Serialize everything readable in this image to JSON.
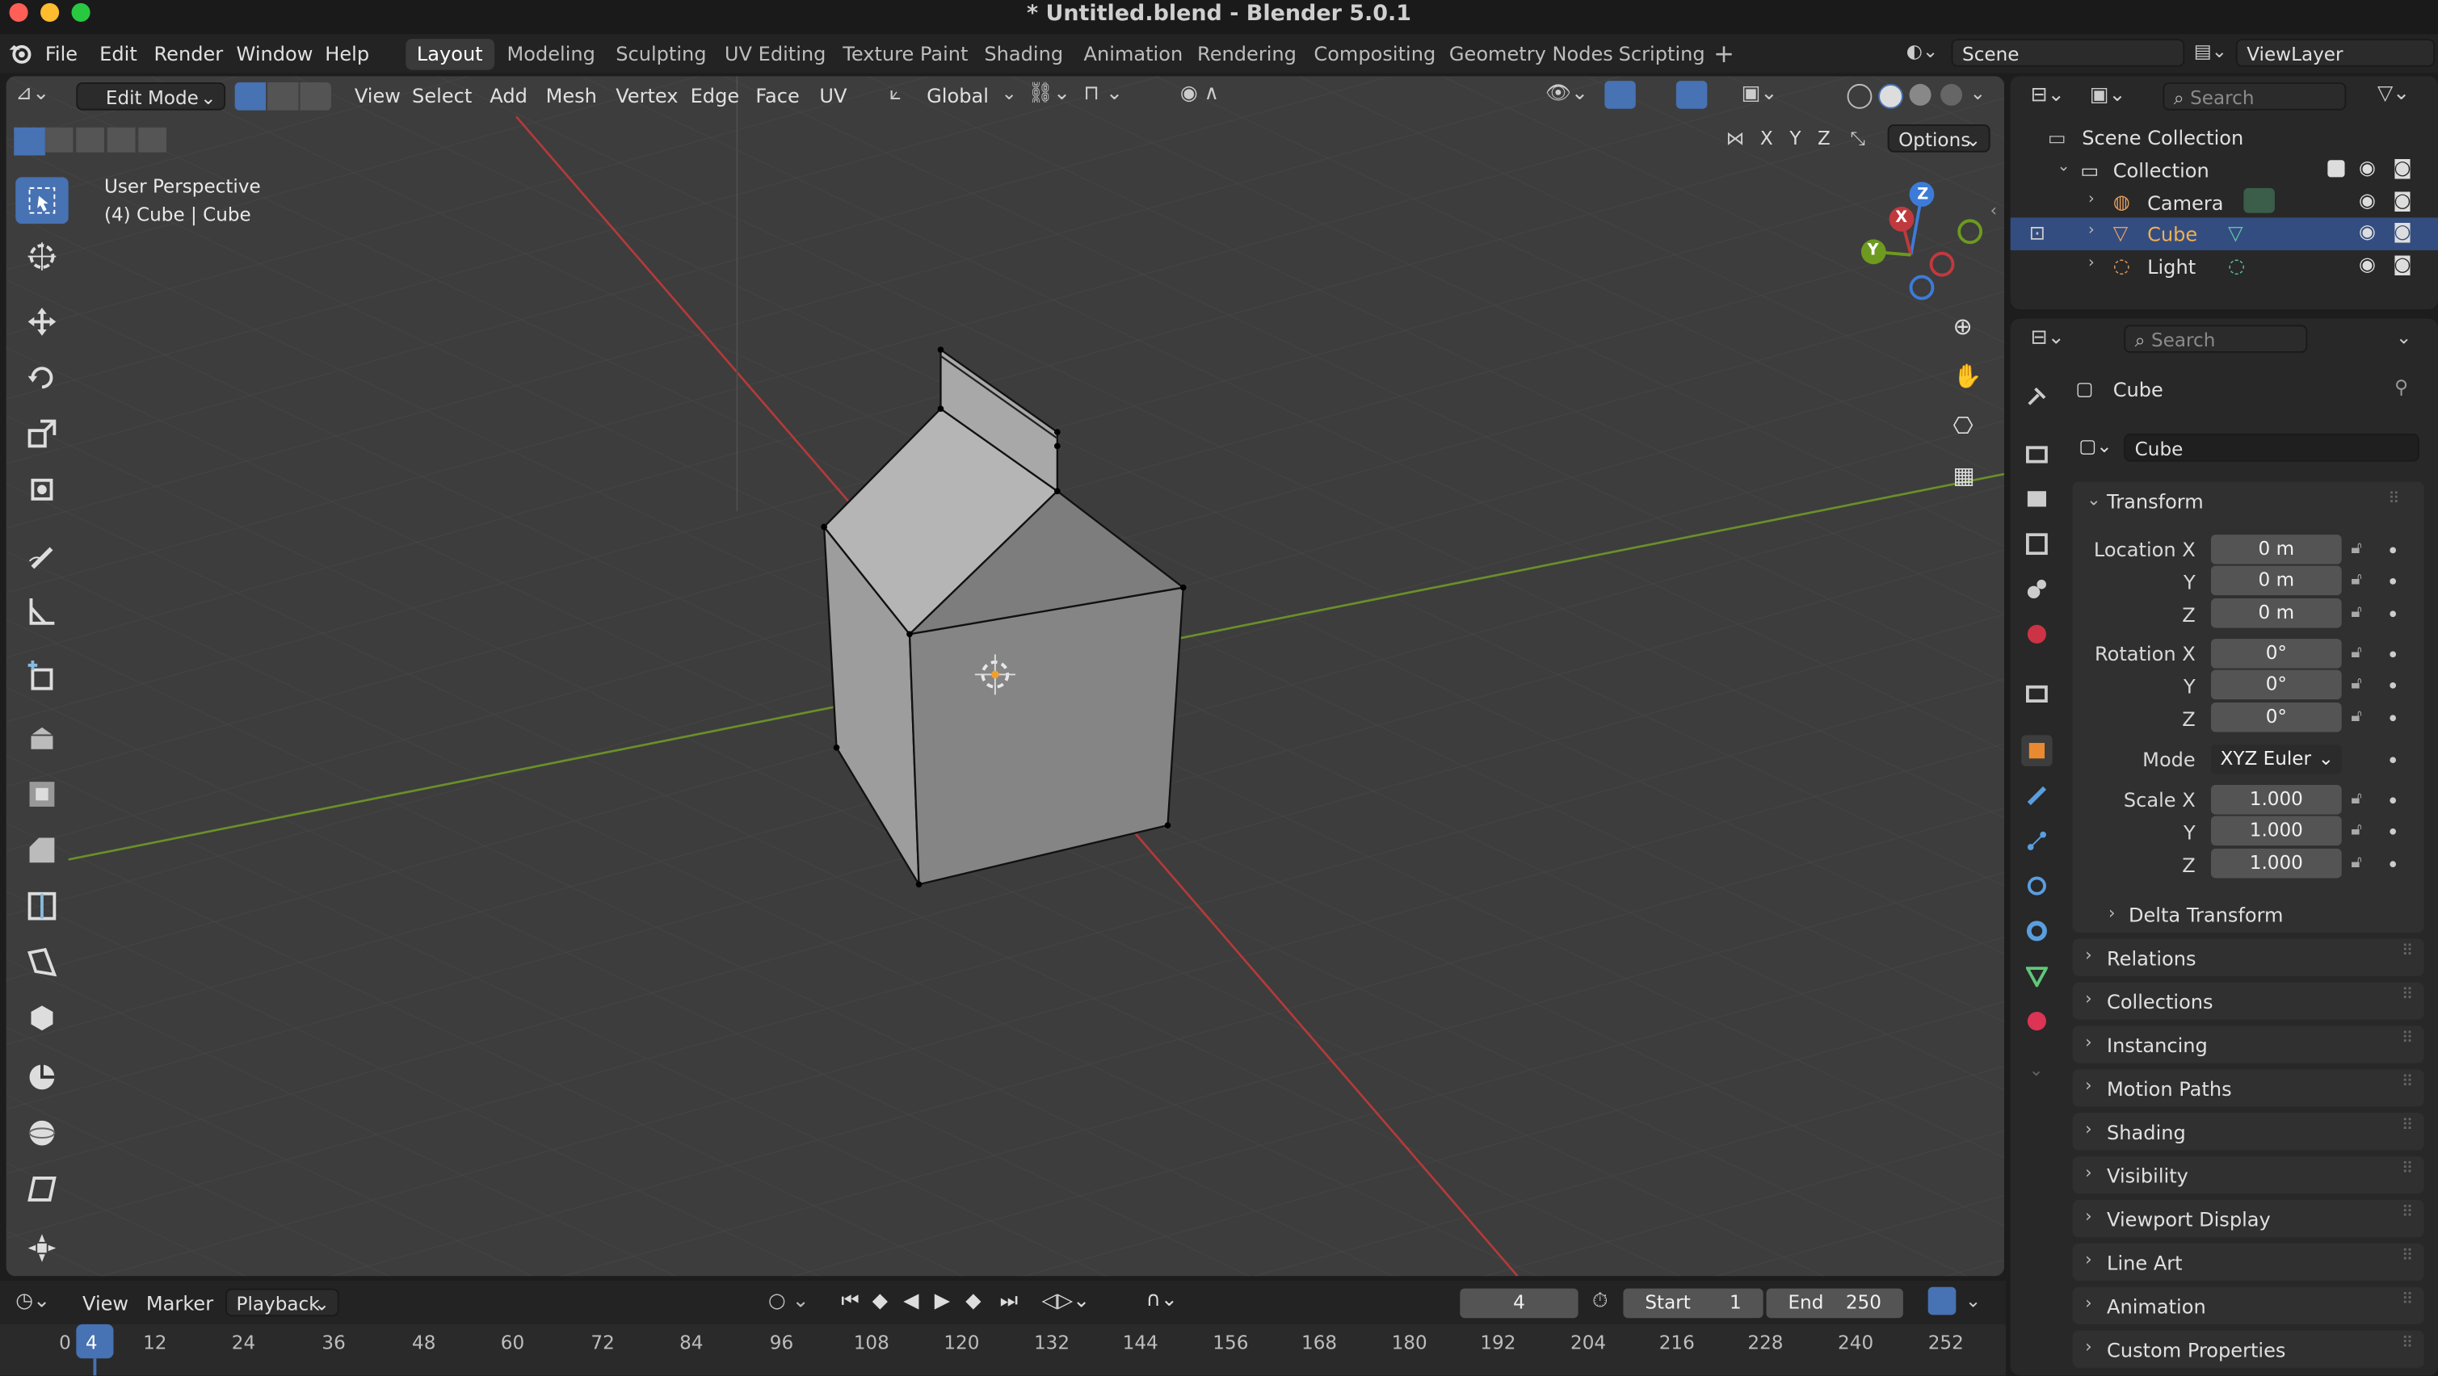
{
  "window": {
    "title": "* Untitled.blend - Blender 5.0.1"
  },
  "menubar": {
    "items": [
      "File",
      "Edit",
      "Render",
      "Window",
      "Help"
    ]
  },
  "workspaces": {
    "tabs": [
      "Layout",
      "Modeling",
      "Sculpting",
      "UV Editing",
      "Texture Paint",
      "Shading",
      "Animation",
      "Rendering",
      "Compositing",
      "Geometry Nodes",
      "Scripting"
    ],
    "active": "Layout"
  },
  "scene": {
    "name": "Scene",
    "view_layer": "ViewLayer"
  },
  "viewport_header": {
    "mode": "Edit Mode",
    "menus": [
      "View",
      "Select",
      "Add",
      "Mesh",
      "Vertex",
      "Edge",
      "Face",
      "UV"
    ],
    "orientation": "Global",
    "options_label": "Options",
    "axes": [
      "X",
      "Y",
      "Z"
    ]
  },
  "viewport": {
    "info_line1": "User Perspective",
    "info_line2": "(4) Cube | Cube",
    "gizmo_x": "X",
    "gizmo_y": "Y",
    "gizmo_z": "Z"
  },
  "outliner": {
    "search_placeholder": "Search",
    "scene_collection": "Scene Collection",
    "collection": "Collection",
    "objects": [
      "Camera",
      "Cube",
      "Light"
    ],
    "selected": "Cube"
  },
  "properties": {
    "search_placeholder": "Search",
    "object_name": "Cube",
    "object_field": "Cube",
    "transform_title": "Transform",
    "location_label": "Location X",
    "rotation_label": "Rotation X",
    "scale_label": "Scale X",
    "mode_label": "Mode",
    "y_label": "Y",
    "z_label": "Z",
    "location": [
      "0 m",
      "0 m",
      "0 m"
    ],
    "rotation": [
      "0°",
      "0°",
      "0°"
    ],
    "rotation_mode": "XYZ Euler",
    "scale": [
      "1.000",
      "1.000",
      "1.000"
    ],
    "delta_transform": "Delta Transform",
    "panels": [
      "Relations",
      "Collections",
      "Instancing",
      "Motion Paths",
      "Shading",
      "Visibility",
      "Viewport Display",
      "Line Art",
      "Animation",
      "Custom Properties"
    ]
  },
  "timeline": {
    "menus": [
      "View",
      "Marker",
      "Playback"
    ],
    "current_frame": "4",
    "start_label": "Start",
    "start": "1",
    "end_label": "End",
    "end": "250",
    "ruler": [
      "0",
      "12",
      "24",
      "36",
      "48",
      "60",
      "72",
      "84",
      "96",
      "108",
      "120",
      "132",
      "144",
      "156",
      "168",
      "180",
      "192",
      "204",
      "216",
      "228",
      "240",
      "252"
    ],
    "playhead": "4"
  },
  "colors": {
    "accent": "#4772b3",
    "x_axis": "#c0393e",
    "y_axis": "#6d9a1f",
    "z_axis": "#3d7bd8"
  }
}
